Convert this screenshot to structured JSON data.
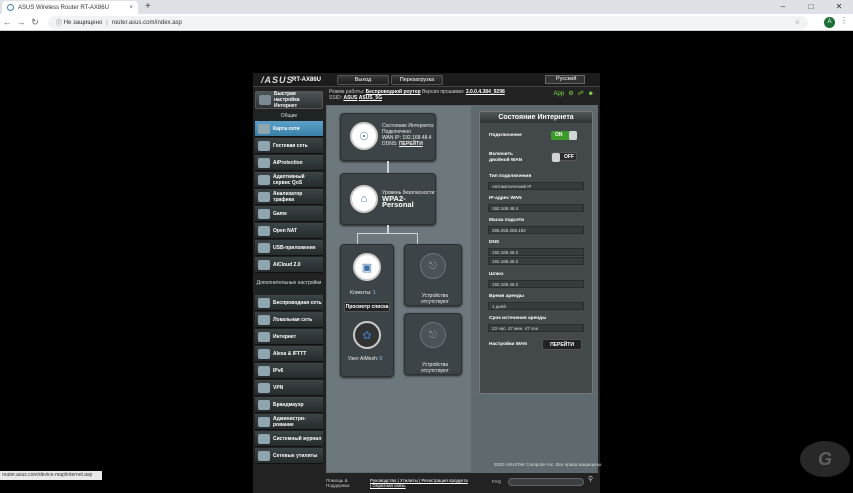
{
  "browser": {
    "tab_title": "ASUS Wireless Router RT-AX86U",
    "tab_close": "×",
    "new_tab": "+",
    "security_label": "Не защищено",
    "url": "router.asus.com/index.asp",
    "status_url": "router.asus.com/device-map/internet.asp",
    "profile_initial": "A"
  },
  "router": {
    "brand": "/ASUS",
    "model": "RT-AX86U",
    "logout_label": "Выход",
    "reboot_label": "Перезагрузка",
    "language": "Русский",
    "mode_prefix": "Режим работы:",
    "mode_value": "Беспроводной роутер",
    "firmware_prefix": "Версия прошивки:",
    "firmware_value": "3.0.0.4.384_9298",
    "ssid_prefix": "SSID:",
    "ssid_1": "ASUS",
    "ssid_2": "ASUS_5G",
    "status_app": "App"
  },
  "sidebar": {
    "quick_setup": "Быстрая настройка Интернет",
    "general_title": "Общие",
    "general_items": [
      "Карта сети",
      "Гостевая сеть",
      "AiProtection",
      "Адаптивный сервис QoS",
      "Анализатор трафика",
      "Game",
      "Open NAT",
      "USB-приложение",
      "AiCloud 2.0"
    ],
    "advanced_title": "Дополнительные настройки",
    "advanced_items": [
      "Беспроводная сеть",
      "Локальная сеть",
      "Интернет",
      "Alexa & IFTTT",
      "IPv6",
      "VPN",
      "Брандмауэр",
      "Администри-рование",
      "Системный журнал",
      "Сетевые утилиты"
    ]
  },
  "map": {
    "internet_status": "Состояние Интернета:",
    "internet_state": "Подключено",
    "wan_ip": "WAN IP: 192.168.48.4",
    "ddns_prefix": "DDNS:",
    "ddns_link": "ПЕРЕЙТИ",
    "security_level": "Уровень безопасности:",
    "security_value": "WPA2-Personal",
    "clients_label": "Клиенты:",
    "clients_count": "1",
    "view_list": "Просмотр списка",
    "aimesh_label": "Узел AiMesh:",
    "aimesh_count": "0",
    "usb1_label": "Устройства отсутствуют",
    "usb2_label": "Устройства отсутствуют"
  },
  "panel": {
    "title": "Состояние Интернета",
    "connection_label": "Подключение",
    "connection_toggle": "ON",
    "dual_wan_label": "Включить двойной WAN",
    "dual_wan_toggle": "OFF",
    "conn_type_label": "Тип подключения",
    "conn_type_value": "Автоматический IP",
    "wan_ip_label": "IP-адрес WAN",
    "wan_ip_value": "192.168.48.4",
    "mask_label": "Маска подсети",
    "mask_value": "255.255.255.192",
    "dns_label": "DNS",
    "dns_1": "192.168.48.2",
    "dns_2": "192.168.48.2",
    "gateway_label": "Шлюз",
    "gateway_value": "192.168.48.2",
    "lease_label": "Время аренды",
    "lease_value": "1 дней",
    "lease_left_label": "Срок истечения аренды",
    "lease_left_value": "23 час. 47 мин. 47 сек.",
    "wan_settings_label": "Настройки WAN",
    "go_button": "ПЕРЕЙТИ"
  },
  "footer": {
    "help_label": "Помощь & Поддержка",
    "links": "Руководство | Утилиты | Регистрация продукта | Обратная связь",
    "faq": "FAQ",
    "copyright": "2020 ASUSTeK Computer Inc. Все права защищены."
  },
  "colors": {
    "accent": "#3b7fa6",
    "on_green": "#3c9a2a",
    "status_green": "#7fdc3d"
  }
}
